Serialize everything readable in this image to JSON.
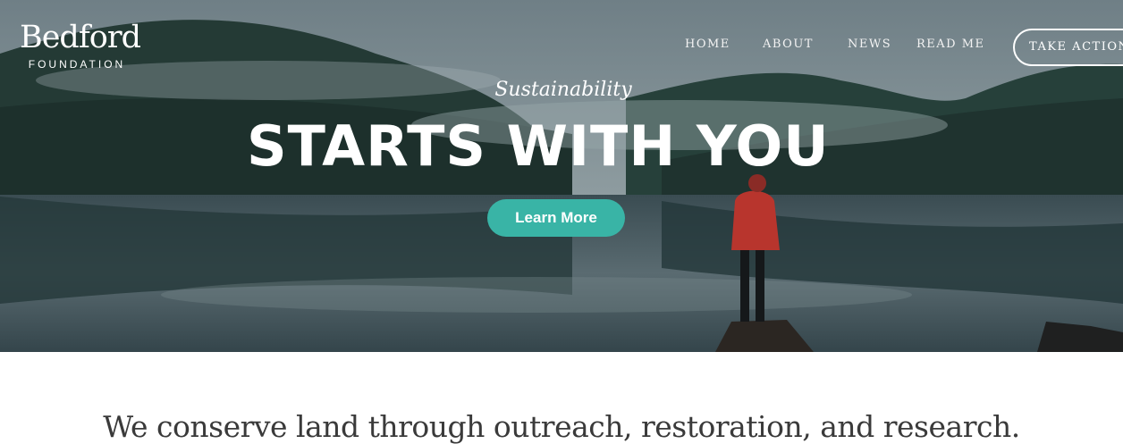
{
  "logo": {
    "name": "Bedford",
    "subtitle": "FOUNDATION"
  },
  "nav": {
    "items": [
      {
        "label": "HOME"
      },
      {
        "label": "ABOUT"
      },
      {
        "label": "NEWS"
      },
      {
        "label": "READ ME"
      }
    ],
    "cta_label": "TAKE ACTION"
  },
  "hero": {
    "kicker": "Sustainability",
    "headline": "STARTS WITH YOU",
    "button_label": "Learn More"
  },
  "mission": {
    "text": "We conserve land through outreach, restoration, and research."
  },
  "colors": {
    "accent": "#39b4a6",
    "text_dark": "#3a3a3a",
    "overlay_text": "#ffffff"
  }
}
